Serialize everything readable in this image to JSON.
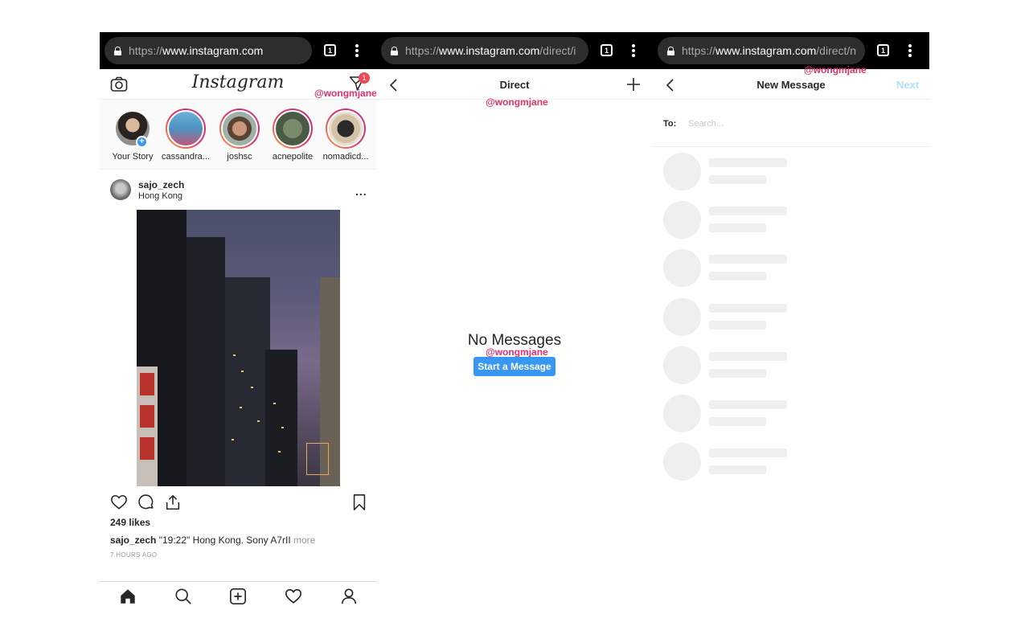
{
  "watermark": "@wongmjane",
  "colors": {
    "instagram_blue": "#3897f0",
    "notification_red": "#ed4956",
    "watermark_pink": "#e1306c",
    "next_disabled": "#b2dffc"
  },
  "feed": {
    "browser": {
      "scheme": "https://",
      "host": "www.instagram.com",
      "path": "",
      "tab_count": "1"
    },
    "logo": "Instagram",
    "direct_badge": "1",
    "stories": [
      {
        "label": "Your Story"
      },
      {
        "label": "cassandra..."
      },
      {
        "label": "joshsc"
      },
      {
        "label": "acnepolite"
      },
      {
        "label": "nomadicd..."
      }
    ],
    "post": {
      "username": "sajo_zech",
      "location": "Hong Kong",
      "likes": "249 likes",
      "caption_user": "sajo_zech",
      "caption_text": " \"19:22\" Hong Kong. Sony A7rII",
      "caption_more": " more",
      "time_ago": "7 HOURS AGO"
    },
    "icons": [
      "camera-icon",
      "direct-icon",
      "heart-icon",
      "comment-icon",
      "share-icon",
      "bookmark-icon",
      "home-icon",
      "search-icon",
      "add-icon",
      "activity-icon",
      "profile-icon"
    ]
  },
  "direct": {
    "browser": {
      "scheme": "https://",
      "host": "www.instagram.com",
      "path": "/direct/i",
      "tab_count": "1"
    },
    "title": "Direct",
    "empty_title": "No Messages",
    "start_button": "Start a Message"
  },
  "new_message": {
    "browser": {
      "scheme": "https://",
      "host": "www.instagram.com",
      "path": "/direct/n",
      "tab_count": "1"
    },
    "title": "New Message",
    "next": "Next",
    "to_label": "To:",
    "search_placeholder": "Search..."
  }
}
